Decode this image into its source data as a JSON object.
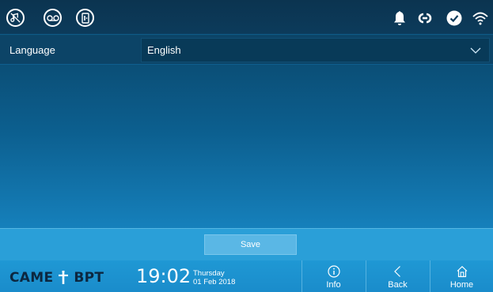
{
  "topbar": {
    "left_icons": [
      "mute-ringtone-icon",
      "answering-machine-icon",
      "door-open-icon"
    ],
    "right_icons": [
      "bell-icon",
      "link-icon",
      "checkmark-icon",
      "wifi-icon"
    ]
  },
  "settings": {
    "language_label": "Language",
    "language_value": "English"
  },
  "actions": {
    "save_label": "Save"
  },
  "footer": {
    "brand_left": "CAME",
    "brand_right": "BPT",
    "time": "19:02",
    "weekday": "Thursday",
    "date": "01 Feb 2018",
    "nav": {
      "info_label": "Info",
      "back_label": "Back",
      "home_label": "Home"
    }
  }
}
